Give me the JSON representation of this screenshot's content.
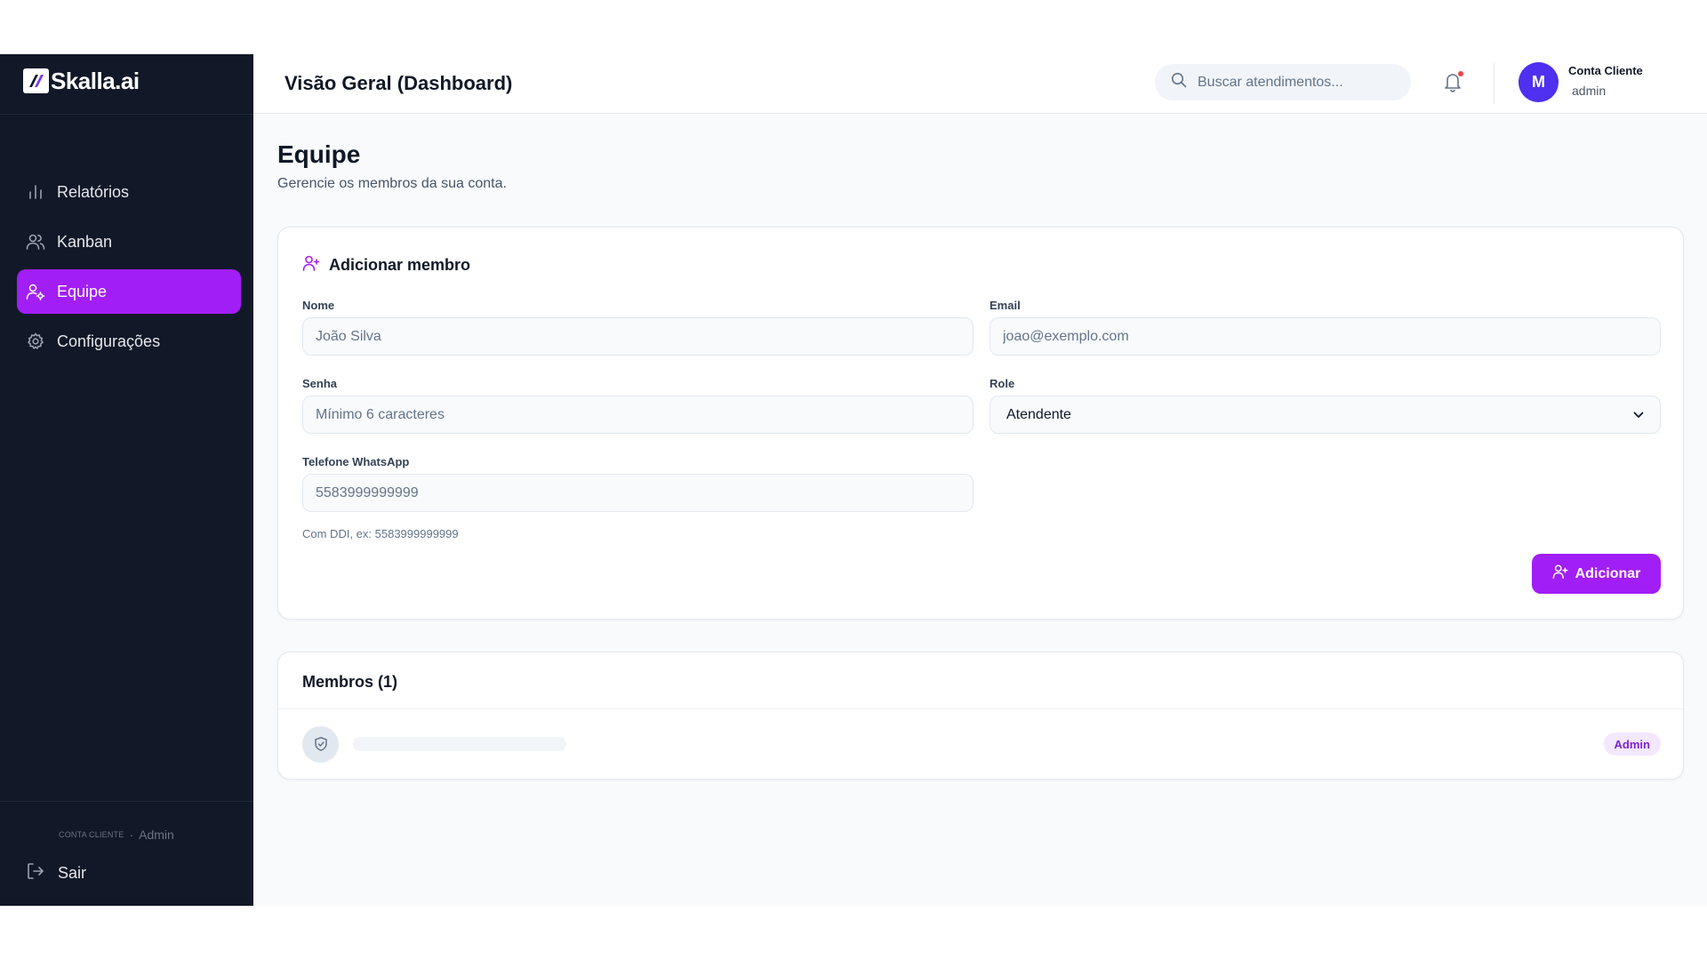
{
  "brand": {
    "name": "Skalla.ai",
    "accent": "#a21ef6",
    "sidebar_bg": "#111827"
  },
  "sidebar": {
    "items": [
      {
        "label": "Relatórios",
        "icon": "bar-chart-icon",
        "active": false
      },
      {
        "label": "Kanban",
        "icon": "users-icon",
        "active": false
      },
      {
        "label": "Equipe",
        "icon": "user-cog-icon",
        "active": true
      },
      {
        "label": "Configurações",
        "icon": "gear-icon",
        "active": false
      }
    ],
    "account_label": "CONTA CLIENTE",
    "account_separator": "·",
    "account_role": "Admin",
    "logout_label": "Sair"
  },
  "header": {
    "title": "Visão Geral (Dashboard)",
    "search_placeholder": "Buscar atendimentos...",
    "user": {
      "initial": "M",
      "name": "Conta Cliente",
      "role": "admin"
    }
  },
  "page": {
    "title": "Equipe",
    "subtitle": "Gerencie os membros da sua conta."
  },
  "add_member": {
    "title": "Adicionar membro",
    "fields": {
      "name": {
        "label": "Nome",
        "placeholder": "João Silva"
      },
      "email": {
        "label": "Email",
        "placeholder": "joao@exemplo.com"
      },
      "password": {
        "label": "Senha",
        "placeholder": "Mínimo 6 caracteres"
      },
      "role": {
        "label": "Role",
        "value": "Atendente"
      },
      "phone": {
        "label": "Telefone WhatsApp",
        "placeholder": "5583999999999",
        "helper": "Com DDI, ex: 5583999999999"
      }
    },
    "submit_label": "Adicionar"
  },
  "members": {
    "title": "Membros (1)",
    "rows": [
      {
        "icon": "shield-check-icon",
        "badge": "Admin"
      }
    ]
  }
}
